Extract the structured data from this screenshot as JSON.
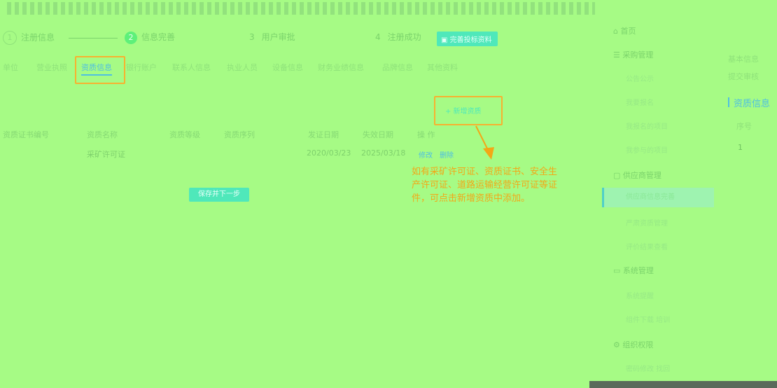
{
  "steps": [
    {
      "num": "1",
      "label": "注册信息"
    },
    {
      "num": "2",
      "label": "信息完善"
    },
    {
      "num": "3",
      "label": "用户审批"
    },
    {
      "num": "4",
      "label": "注册成功"
    }
  ],
  "status_tag": "完善投标资料",
  "tabs": [
    "单位",
    "营业执照",
    "资质信息",
    "银行账户",
    "联系人信息",
    "执业人员",
    "设备信息",
    "财务业绩信息",
    "品牌信息",
    "其他资料"
  ],
  "add_button": "+ 新增资质",
  "table": {
    "headers": [
      "资质证书编号",
      "资质名称",
      "资质等级",
      "资质序列",
      "发证日期",
      "失效日期",
      "操 作"
    ],
    "rows": [
      {
        "cert_no": "",
        "name": "采矿许可证",
        "level": "",
        "sequence": "",
        "issue": "2020/03/23",
        "expire": "2025/03/18",
        "edit": "修改",
        "delete": "删除"
      }
    ]
  },
  "save_button": "保存并下一步",
  "annotation": "如有采矿许可证、资质证书、安全生产许可证、道路运输经营许可证等证件，可点击新增资质中添加。",
  "sidebar": {
    "top": "首页",
    "groups": [
      {
        "title": "采购管理",
        "items": [
          "公告公示",
          "我要报名",
          "我报名的项目",
          "我参与的项目"
        ]
      },
      {
        "title": "供应商管理",
        "items": [
          "供应商信息完善",
          "严肃资质管理",
          "评价结果查看"
        ]
      },
      {
        "title": "系统管理",
        "items": [
          "系统提醒",
          "组件下载  培训"
        ]
      },
      {
        "title": "组织权限",
        "items": [
          "密码修改  找回"
        ]
      }
    ]
  },
  "right_panel": {
    "tab1": "基本信息",
    "tab2": "提交审核",
    "section": "资质信息",
    "col": "序号",
    "row1": "1"
  }
}
